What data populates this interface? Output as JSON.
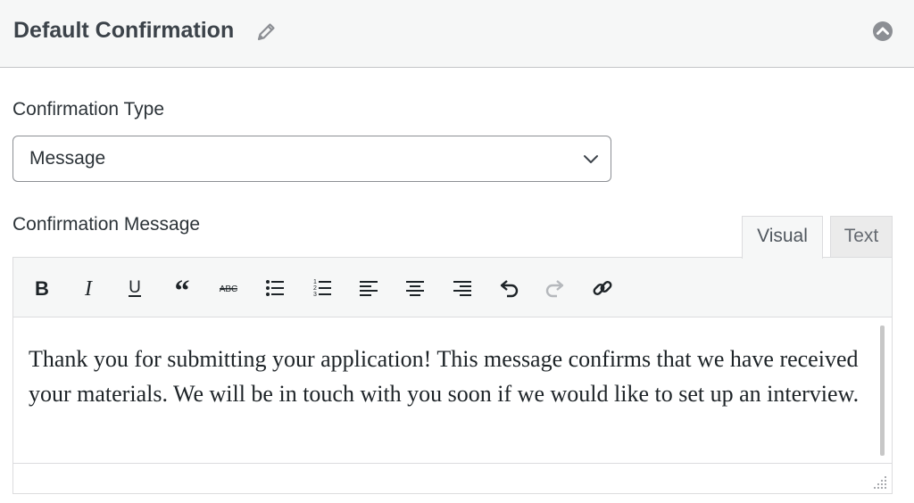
{
  "header": {
    "title": "Default Confirmation",
    "edit_icon": "pencil-icon",
    "collapse_icon": "chevron-up-circle-icon"
  },
  "confirmation_type": {
    "label": "Confirmation Type",
    "selected_value": "Message"
  },
  "confirmation_message": {
    "label": "Confirmation Message",
    "tabs": [
      {
        "label": "Visual",
        "active": true
      },
      {
        "label": "Text",
        "active": false
      }
    ],
    "toolbar": [
      "bold-icon",
      "italic-icon",
      "underline-icon",
      "blockquote-icon",
      "strikethrough-icon",
      "bulleted-list-icon",
      "numbered-list-icon",
      "align-left-icon",
      "align-center-icon",
      "align-right-icon",
      "undo-icon",
      "redo-icon",
      "link-icon"
    ],
    "body": "Thank you for submitting your application! This message confirms that we have received your materials. We will be in touch with you soon if we would like to set up an interview."
  },
  "colors": {
    "header_bg": "#f6f7f7",
    "text": "#2c3338",
    "border": "#dcdcde",
    "icon_gray": "#8c8f94"
  }
}
